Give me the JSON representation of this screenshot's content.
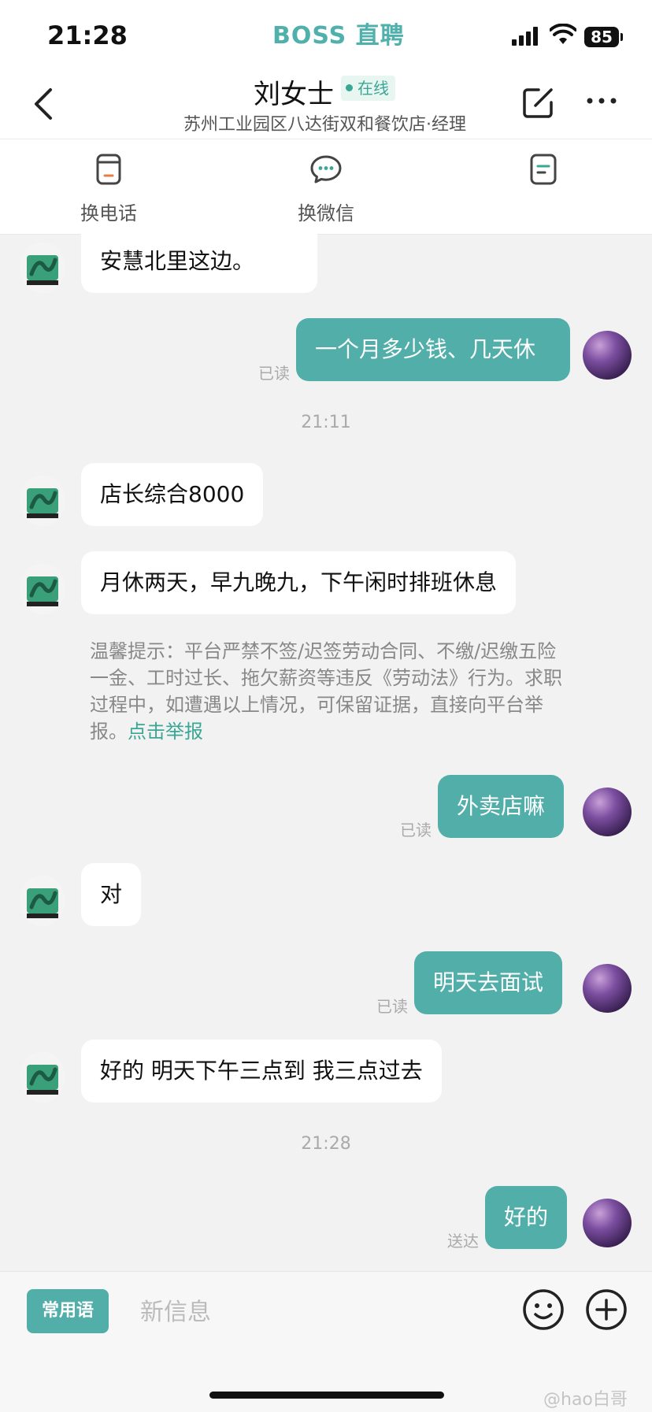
{
  "status": {
    "time": "21:28",
    "brand": "BOSS 直聘",
    "battery": "85"
  },
  "header": {
    "name": "刘女士",
    "online": "在线",
    "subtitle": "苏州工业园区八达街双和餐饮店·经理"
  },
  "actions": [
    {
      "label": "换电话",
      "icon": "phone-card-icon"
    },
    {
      "label": "换微信",
      "icon": "wechat-icon"
    },
    {
      "label": "",
      "icon": "resume-icon"
    }
  ],
  "messages": {
    "m1": "安慧北里这边。",
    "m2": "一个月多少钱、几天休",
    "m2_read": "已读",
    "ts1": "21:11",
    "m3": "店长综合8000",
    "m4": "月休两天，早九晚九，下午闲时排班休息",
    "tip": "温馨提示：平台严禁不签/迟签劳动合同、不缴/迟缴五险一金、工时过长、拖欠薪资等违反《劳动法》行为。求职过程中，如遭遇以上情况，可保留证据，直接向平台举报。",
    "tip_link": "点击举报",
    "m5": "外卖店嘛",
    "m5_read": "已读",
    "m6": "对",
    "m7": "明天去面试",
    "m7_read": "已读",
    "m8": "好的 明天下午三点到 我三点过去",
    "ts2": "21:28",
    "m9": "好的",
    "m9_status": "送达"
  },
  "input": {
    "phrases": "常用语",
    "placeholder": "新信息"
  },
  "watermark": "@hao白哥",
  "colors": {
    "accent": "#52aea9",
    "online": "#3aa694"
  }
}
